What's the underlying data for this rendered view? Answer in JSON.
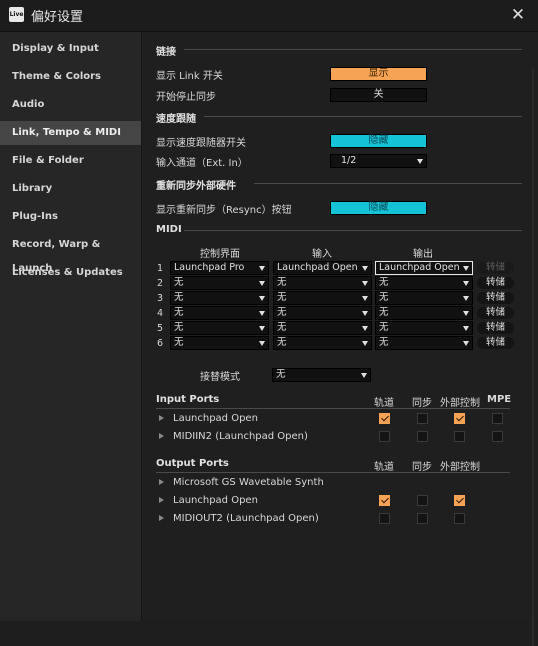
{
  "window": {
    "title": "偏好设置",
    "app_icon_text": "Live"
  },
  "sidebar": {
    "items": [
      {
        "label": "Display & Input"
      },
      {
        "label": "Theme & Colors"
      },
      {
        "label": "Audio"
      },
      {
        "label": "Link, Tempo & MIDI",
        "active": true
      },
      {
        "label": "File & Folder"
      },
      {
        "label": "Library"
      },
      {
        "label": "Plug-Ins"
      },
      {
        "label": "Record, Warp & Launch"
      },
      {
        "label": "Licenses & Updates"
      }
    ]
  },
  "link": {
    "header": "链接",
    "show_link_label": "显示 Link 开关",
    "show_link_value": "显示",
    "start_stop_label": "开始停止同步",
    "start_stop_value": "关"
  },
  "tempo": {
    "header": "速度跟随",
    "show_follower_label": "显示速度跟随器开关",
    "show_follower_value": "隐藏",
    "input_channel_label": "输入通道（Ext. In）",
    "input_channel_value": "1/2"
  },
  "resync": {
    "header": "重新同步外部硬件",
    "show_resync_label": "显示重新同步（Resync）按钮",
    "show_resync_value": "隐藏"
  },
  "midi": {
    "header": "MIDI",
    "col_control": "控制界面",
    "col_input": "输入",
    "col_output": "输出",
    "rows": [
      {
        "no": "1",
        "control": "Launchpad Pro",
        "input": "Launchpad Open",
        "output": "Launchpad Open",
        "dump": "转储"
      },
      {
        "no": "2",
        "control": "无",
        "input": "无",
        "output": "无",
        "dump": "转储"
      },
      {
        "no": "3",
        "control": "无",
        "input": "无",
        "output": "无",
        "dump": "转储"
      },
      {
        "no": "4",
        "control": "无",
        "input": "无",
        "output": "无",
        "dump": "转储"
      },
      {
        "no": "5",
        "control": "无",
        "input": "无",
        "output": "无",
        "dump": "转储"
      },
      {
        "no": "6",
        "control": "无",
        "input": "无",
        "output": "无",
        "dump": "转储"
      }
    ],
    "takeover_label": "接替模式",
    "takeover_value": "无"
  },
  "ports": {
    "input_header": "Input Ports",
    "output_header": "Output Ports",
    "col_track": "轨道",
    "col_sync": "同步",
    "col_remote": "外部控制",
    "col_mpe": "MPE",
    "inputs": [
      {
        "name": "Launchpad Open",
        "track": true,
        "sync": false,
        "remote": true,
        "mpe": false
      },
      {
        "name": "MIDIIN2 (Launchpad Open)",
        "track": false,
        "sync": false,
        "remote": false,
        "mpe": false
      }
    ],
    "outputs": [
      {
        "name": "Microsoft GS Wavetable Synth",
        "track": null,
        "sync": null,
        "remote": null
      },
      {
        "name": "Launchpad Open",
        "track": true,
        "sync": false,
        "remote": true
      },
      {
        "name": "MIDIOUT2 (Launchpad Open)",
        "track": false,
        "sync": false,
        "remote": false
      }
    ]
  },
  "colors": {
    "accent_orange": "#f7a355",
    "accent_cyan": "#14c4d6",
    "background": "#1f1f1f",
    "sidebar_bg": "#262626"
  }
}
